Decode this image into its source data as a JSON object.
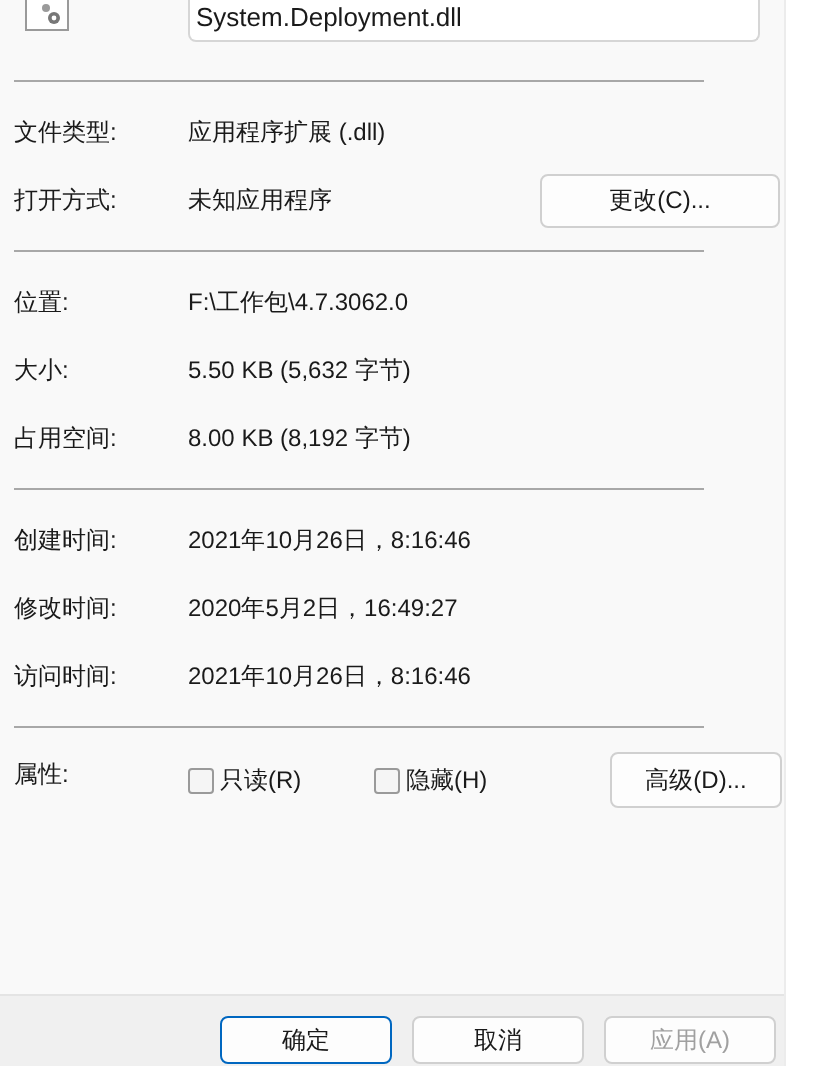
{
  "file_name": "System.Deployment.dll",
  "type_rows": [
    {
      "label": "文件类型:",
      "value": "应用程序扩展 (.dll)"
    },
    {
      "label": "打开方式:",
      "value": "未知应用程序",
      "button": "更改(C)..."
    }
  ],
  "location_rows": [
    {
      "label": "位置:",
      "value": "F:\\工作包\\4.7.3062.0"
    },
    {
      "label": "大小:",
      "value": "5.50 KB (5,632 字节)"
    },
    {
      "label": "占用空间:",
      "value": "8.00 KB (8,192 字节)"
    }
  ],
  "time_rows": [
    {
      "label": "创建时间:",
      "value": "2021年10月26日，8:16:46"
    },
    {
      "label": "修改时间:",
      "value": "2020年5月2日，16:49:27"
    },
    {
      "label": "访问时间:",
      "value": "2021年10月26日，8:16:46"
    }
  ],
  "attributes": {
    "label": "属性:",
    "checkboxes": [
      {
        "label": "只读(R)",
        "checked": false
      },
      {
        "label": "隐藏(H)",
        "checked": false
      }
    ],
    "button": "高级(D)..."
  },
  "footer_buttons": [
    {
      "label": "确定",
      "kind": "default",
      "disabled": false
    },
    {
      "label": "取消",
      "kind": "normal",
      "disabled": false
    },
    {
      "label": "应用(A)",
      "kind": "normal",
      "disabled": true
    }
  ]
}
